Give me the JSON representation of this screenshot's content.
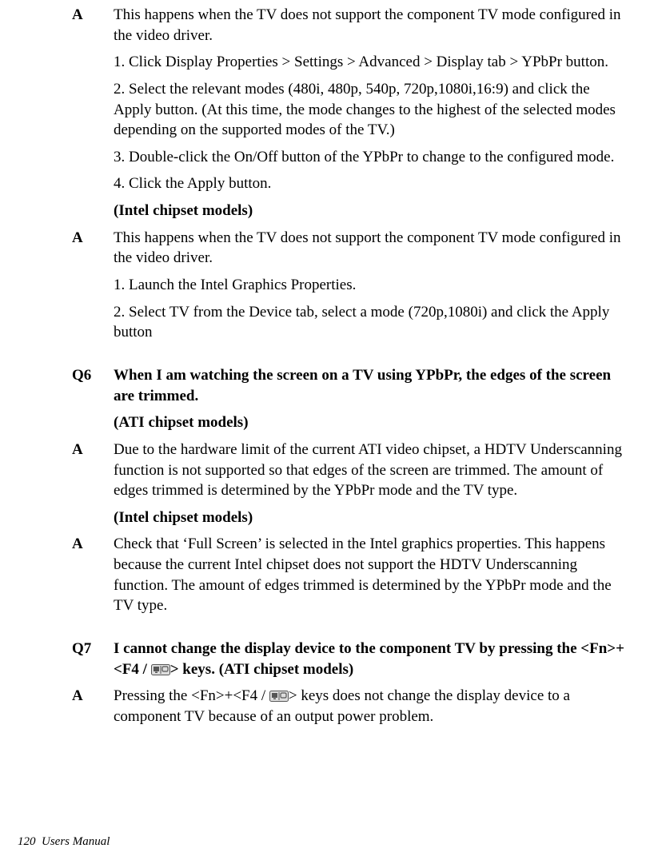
{
  "a1": {
    "label": "A",
    "text": "This happens when the TV does not support the component TV mode configured in the video driver.",
    "step1": "1. Click Display Properties > Settings > Advanced > Display tab > YPbPr button.",
    "step2": "2. Select the relevant modes (480i, 480p, 540p, 720p,1080i,16:9) and click the Apply button. (At this time, the mode changes to the highest of the selected modes depending on the supported modes of the TV.)",
    "step3": "3. Double-click the On/Off button of the YPbPr to change to the configured mode.",
    "step4": "4. Click the Apply button.",
    "note": "(Intel chipset models)"
  },
  "a2": {
    "label": "A",
    "text": "This happens when the TV does not support the component TV mode configured in the video driver.",
    "step1": "1. Launch the Intel Graphics Properties.",
    "step2": "2. Select TV from the Device tab, select a mode (720p,1080i) and click the Apply button"
  },
  "q6": {
    "label": "Q6",
    "text": "When I am watching the screen on a TV using YPbPr, the edges of the screen are trimmed.",
    "note_ati": "(ATI chipset models)",
    "a_ati_label": "A",
    "a_ati_text": "Due to the hardware limit of the current ATI video chipset, a HDTV Underscanning function is not supported so that edges of the screen are trimmed. The amount of edges trimmed is determined by the YPbPr mode and the TV type.",
    "note_intel": "(Intel chipset models)",
    "a_intel_label": "A",
    "a_intel_text": "Check that ‘Full Screen’ is selected in the Intel graphics properties. This happens because the current Intel chipset does not support the HDTV Underscanning function. The amount of edges trimmed is determined by the YPbPr mode and the TV type."
  },
  "q7": {
    "label": "Q7",
    "text_before_icon": "I cannot change the display device to the component TV by pressing the <Fn>+<F4 / ",
    "text_after_icon": "> keys. (ATI chipset models)",
    "a_label": "A",
    "a_before_icon": "Pressing the <Fn>+<F4 / ",
    "a_after_icon": "> keys does not change the display device to a component TV because of an output power problem."
  },
  "footer": {
    "page_number": "120",
    "title": "Users Manual"
  }
}
